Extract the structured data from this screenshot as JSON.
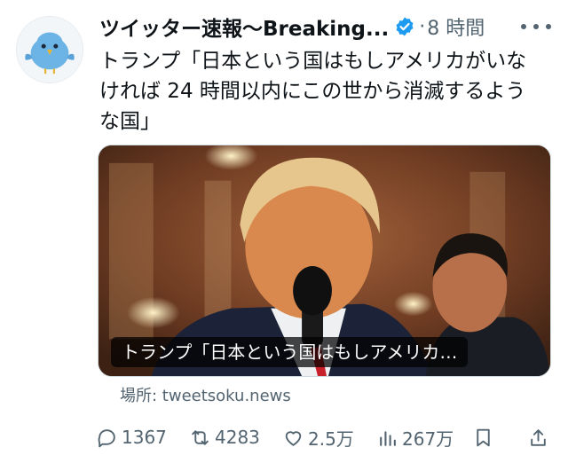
{
  "tweet": {
    "display_name": "ツイッター速報〜Breaking...",
    "separator": "·",
    "time": "8 時間",
    "text_lines": [
      "トランプ「日本という国はもしアメリカがいな",
      "ければ 24 時間以内にこの世から消滅するよう",
      "な国」"
    ],
    "media_caption": "トランプ「日本という国はもしアメリカ…",
    "source": "場所: tweetsoku.news"
  },
  "actions": {
    "replies": "1367",
    "retweets": "4283",
    "likes": "2.5万",
    "views": "267万"
  },
  "icons": {
    "avatar": "blue-bird-icon",
    "verified": "verified-badge-icon",
    "more": "more-options-icon",
    "reply": "reply-icon",
    "retweet": "retweet-icon",
    "like": "heart-icon",
    "views": "views-chart-icon",
    "bookmark": "bookmark-icon",
    "share": "share-icon"
  },
  "colors": {
    "text": "#0f1419",
    "secondary": "#536471",
    "verified": "#1d9bf0",
    "avatar_bird": "#6cb4e6"
  }
}
